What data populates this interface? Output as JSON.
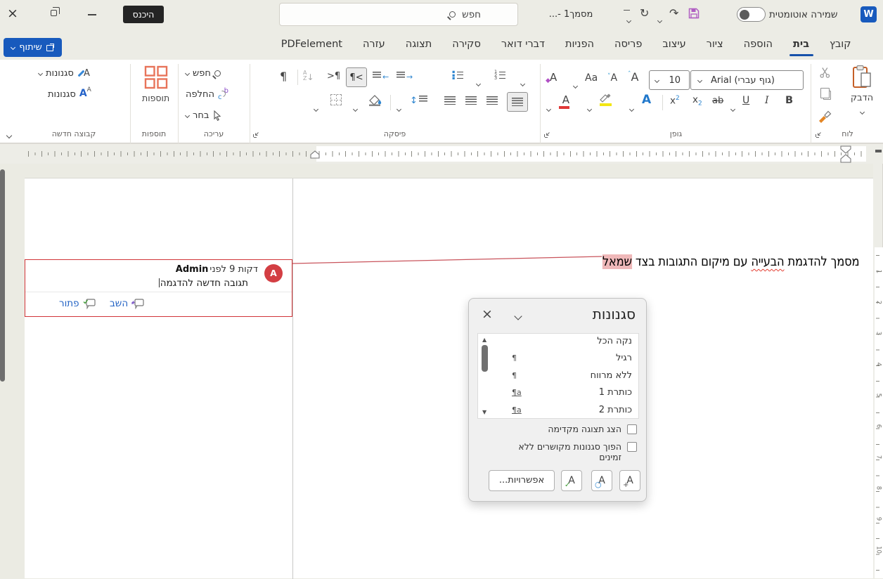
{
  "titlebar": {
    "signin": "היכנס",
    "search_placeholder": "חפש",
    "doc_name": "מסמך1 -...",
    "autosave_label": "שמירה אוטומטית",
    "word_logo": "W"
  },
  "tabs": [
    {
      "label": "קובץ"
    },
    {
      "label": "בית",
      "active": true
    },
    {
      "label": "הוספה"
    },
    {
      "label": "ציור"
    },
    {
      "label": "עיצוב"
    },
    {
      "label": "פריסה"
    },
    {
      "label": "הפניות"
    },
    {
      "label": "דברי דואר"
    },
    {
      "label": "סקירה"
    },
    {
      "label": "תצוגה"
    },
    {
      "label": "עזרה"
    },
    {
      "label": "PDFelement"
    }
  ],
  "share_label": "שיתוף",
  "ribbon": {
    "paste_label": "הדבק",
    "clipboard_group": "לוח",
    "font_group": "גופן",
    "font_name": "Arial (גוף עברי)",
    "font_size": "10",
    "bold": "B",
    "italic": "I",
    "underline": "U",
    "strike": "ab",
    "case_label": "Aa",
    "paragraph_group": "פיסקה",
    "editing_group": "עריכה",
    "find_label": "חפש",
    "replace_label": "החלפה",
    "select_label": "בחר",
    "addins_label": "תוספות",
    "addins_group": "תוספות",
    "styles_label1": "סגנונות",
    "styles_label2": "סגנונות",
    "newgroup_label": "קבוצה חדשה"
  },
  "document": {
    "text_before": "מסמך להדגמת ",
    "text_misspelled": "הבעייה",
    "text_middle": " עם מיקום התגובות בצד ",
    "text_highlight": "שמאל"
  },
  "comment": {
    "avatar": "A",
    "author": "Admin",
    "time": "לפני 9 דקות",
    "body": "תגובה חדשה להדגמה",
    "reply_label": "השב",
    "resolve_label": "פתור"
  },
  "vruler_numbers": [
    "1",
    "2",
    "3",
    "4",
    "5",
    "6",
    "7",
    "8",
    "9",
    "10"
  ],
  "styles_panel": {
    "title": "סגנונות",
    "items": [
      {
        "name": "נקה הכל",
        "icon": ""
      },
      {
        "name": "רגיל",
        "icon": "¶"
      },
      {
        "name": "ללא מרווח",
        "icon": "¶"
      },
      {
        "name": "כותרת 1",
        "icon": "¶a"
      },
      {
        "name": "כותרת 2",
        "icon": "¶a"
      }
    ],
    "checkbox1": "הצג תצוגה מקדימה",
    "checkbox2": "הפוך סגנונות מקושרים ללא זמינים",
    "options_label": "אפשרויות..."
  }
}
